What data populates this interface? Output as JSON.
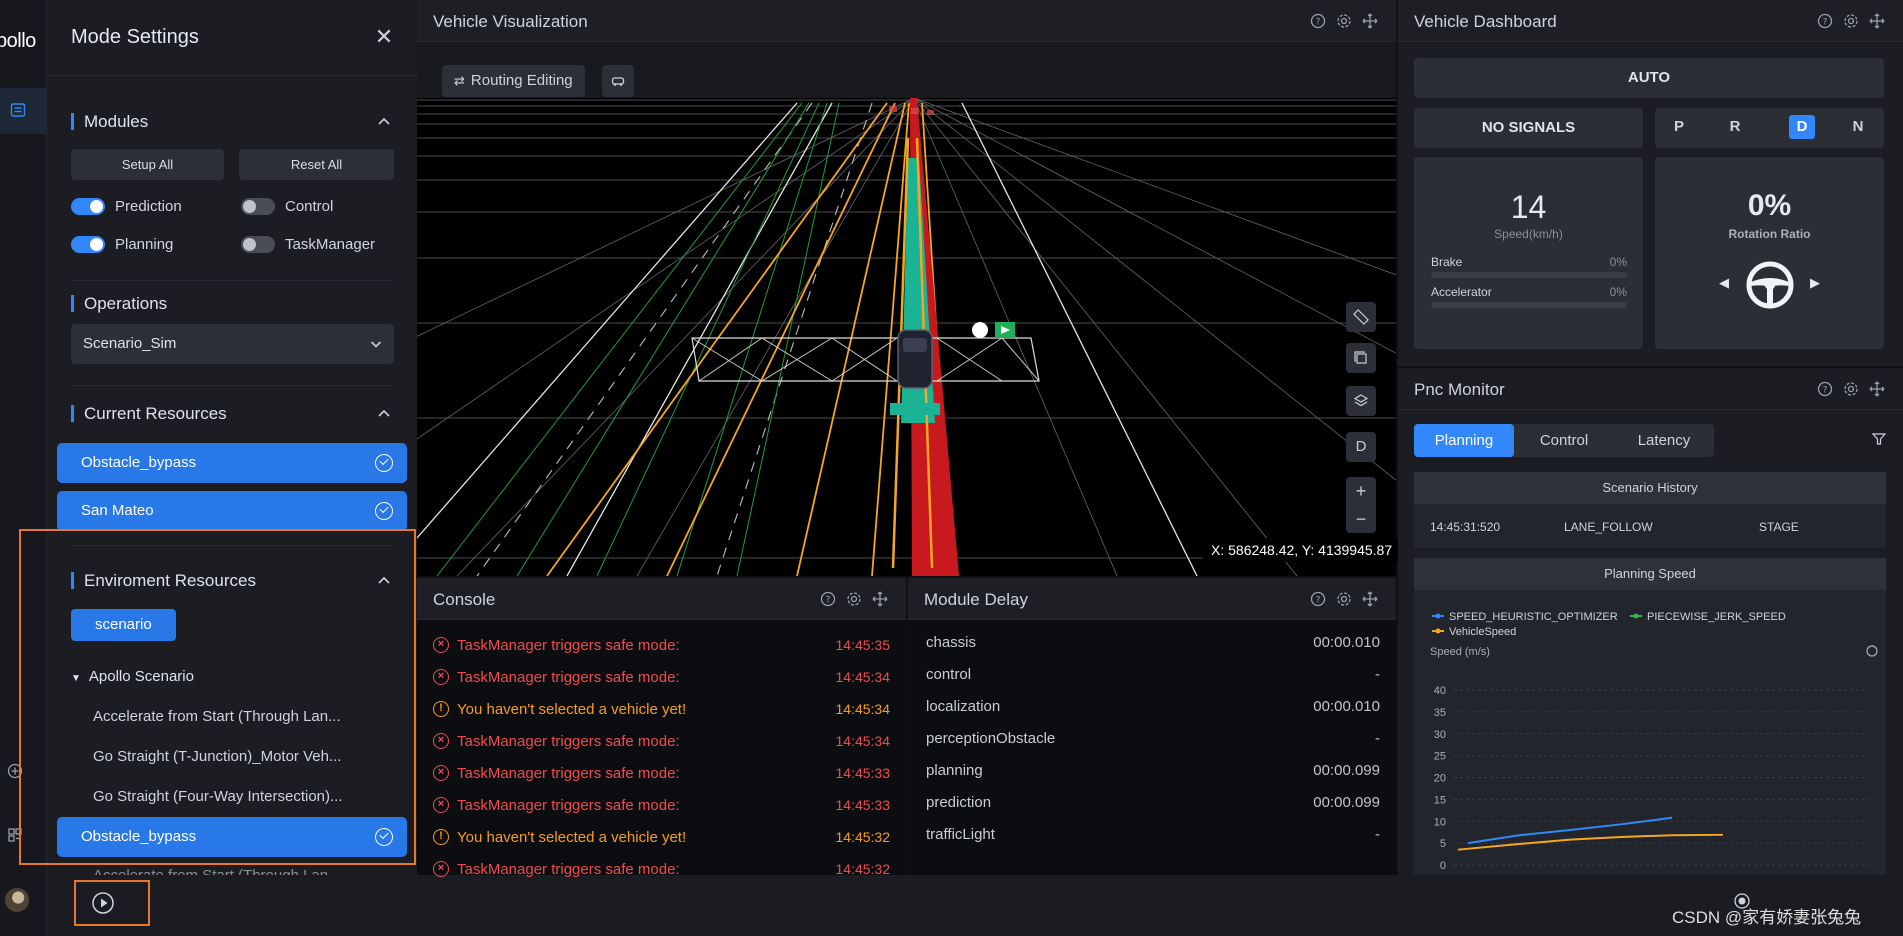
{
  "rail": {
    "logo": "pollo"
  },
  "mode_settings": {
    "title": "Mode Settings",
    "modules": {
      "title": "Modules",
      "setup_all": "Setup All",
      "reset_all": "Reset All",
      "toggles": [
        {
          "label": "Prediction",
          "on": true
        },
        {
          "label": "Control",
          "on": false
        },
        {
          "label": "Planning",
          "on": true
        },
        {
          "label": "TaskManager",
          "on": false
        }
      ]
    },
    "operations": {
      "title": "Operations",
      "selected": "Scenario_Sim"
    },
    "current_resources": {
      "title": "Current Resources",
      "items": [
        "Obstacle_bypass",
        "San Mateo"
      ]
    },
    "environment_resources": {
      "title": "Enviroment Resources",
      "tag": "scenario",
      "group": "Apollo Scenario",
      "items": [
        "Accelerate from Start (Through Lan...",
        "Go Straight (T-Junction)_Motor Veh...",
        "Go Straight (Four-Way Intersection)...",
        "Obstacle_bypass",
        "Accelerate from Start (Through Lan..."
      ],
      "selected_index": 3
    }
  },
  "vehicle_viz": {
    "title": "Vehicle Visualization",
    "routing_editing": "Routing Editing",
    "coords": "X: 586248.42, Y: 4139945.87",
    "side_buttons": [
      "ruler-icon",
      "copy-icon",
      "layers-icon",
      "D",
      "+",
      "−"
    ]
  },
  "console": {
    "title": "Console",
    "logs": [
      {
        "level": "error",
        "msg": "TaskManager triggers safe mode:",
        "time": "14:45:35"
      },
      {
        "level": "error",
        "msg": "TaskManager triggers safe mode:",
        "time": "14:45:34"
      },
      {
        "level": "warn",
        "msg": "You haven't selected a vehicle yet!",
        "time": "14:45:34"
      },
      {
        "level": "error",
        "msg": "TaskManager triggers safe mode:",
        "time": "14:45:34"
      },
      {
        "level": "error",
        "msg": "TaskManager triggers safe mode:",
        "time": "14:45:33"
      },
      {
        "level": "error",
        "msg": "TaskManager triggers safe mode:",
        "time": "14:45:33"
      },
      {
        "level": "warn",
        "msg": "You haven't selected a vehicle yet!",
        "time": "14:45:32"
      },
      {
        "level": "error",
        "msg": "TaskManager triggers safe mode:",
        "time": "14:45:32"
      }
    ]
  },
  "module_delay": {
    "title": "Module Delay",
    "rows": [
      {
        "name": "chassis",
        "value": "00:00.010"
      },
      {
        "name": "control",
        "value": "-"
      },
      {
        "name": "localization",
        "value": "00:00.010"
      },
      {
        "name": "perceptionObstacle",
        "value": "-"
      },
      {
        "name": "planning",
        "value": "00:00.099"
      },
      {
        "name": "prediction",
        "value": "00:00.099"
      },
      {
        "name": "trafficLight",
        "value": "-"
      }
    ]
  },
  "dashboard": {
    "title": "Vehicle Dashboard",
    "mode": "AUTO",
    "signals": "NO SIGNALS",
    "gears": [
      "P",
      "R",
      "D",
      "N"
    ],
    "active_gear": "D",
    "speed": "14",
    "speed_label": "Speed(km/h)",
    "brake_label": "Brake",
    "brake_value": "0%",
    "accel_label": "Accelerator",
    "accel_value": "0%",
    "rotation": "0%",
    "rotation_label": "Rotation Ratio"
  },
  "pnc": {
    "title": "Pnc Monitor",
    "tabs": [
      "Planning",
      "Control",
      "Latency"
    ],
    "active_tab": "Planning",
    "scenario_history": {
      "title": "Scenario History",
      "row": {
        "time": "14:45:31:520",
        "scenario": "LANE_FOLLOW",
        "stage": "STAGE"
      }
    },
    "planning_speed": {
      "title": "Planning Speed"
    }
  },
  "chart_data": {
    "type": "line",
    "title": "Planning Speed",
    "ylabel": "Speed (m/s)",
    "xlabel": "",
    "ylim": [
      0,
      40
    ],
    "yticks": [
      0,
      5,
      10,
      15,
      20,
      25,
      30,
      35,
      40
    ],
    "series": [
      {
        "name": "SPEED_HEURISTIC_OPTIMIZER",
        "color": "#3288fa",
        "x": [
          0,
          1,
          2,
          3,
          4
        ],
        "values": [
          5,
          6.8,
          8,
          9.3,
          10.8
        ]
      },
      {
        "name": "PIECEWISE_JERK_SPEED",
        "color": "#2fb54a",
        "x": [],
        "values": []
      },
      {
        "name": "VehicleSpeed",
        "color": "#f5a623",
        "x": [
          -0.2,
          1,
          2,
          3,
          4,
          5
        ],
        "values": [
          3.5,
          4.8,
          5.8,
          6.4,
          6.8,
          6.9
        ]
      }
    ],
    "legend": "top-left"
  },
  "watermark": "CSDN @家有娇妻张兔兔",
  "colors": {
    "accent": "#3288fa",
    "error": "#f04c4c",
    "warn": "#f59c24",
    "highlight": "#e8772e"
  }
}
